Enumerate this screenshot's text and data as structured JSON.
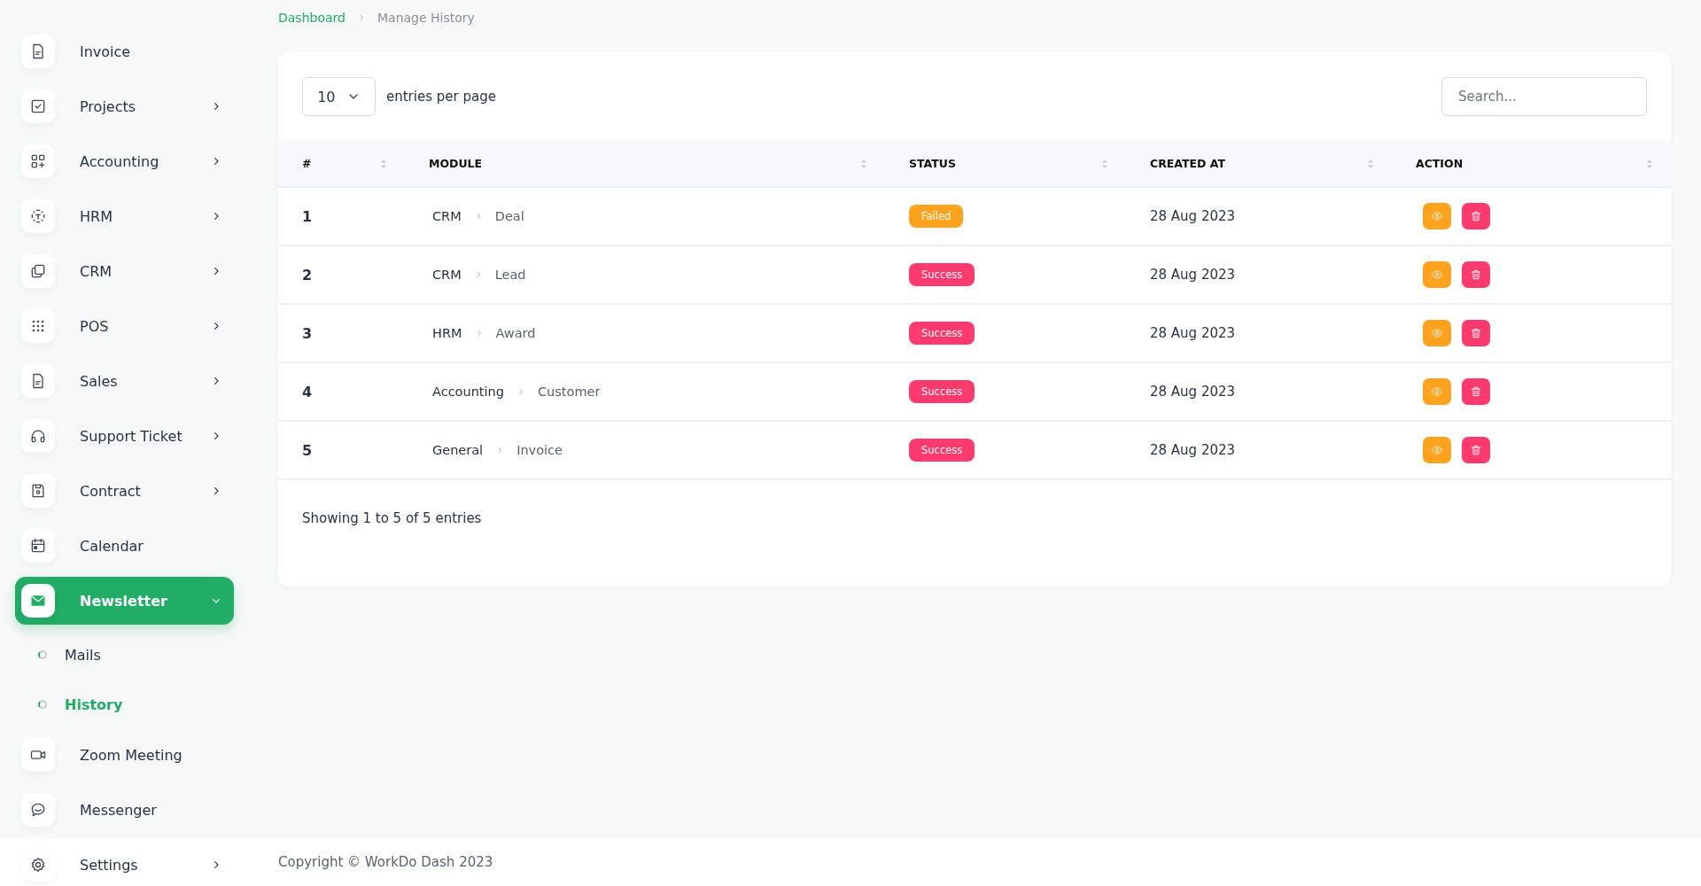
{
  "sidebar": {
    "items": [
      {
        "label": "Invoice",
        "kind": "link",
        "selected": false
      },
      {
        "label": "Projects",
        "kind": "group",
        "expanded": false,
        "selected": false
      },
      {
        "label": "Accounting",
        "kind": "group",
        "expanded": false,
        "selected": false
      },
      {
        "label": "HRM",
        "kind": "group",
        "expanded": false,
        "selected": false
      },
      {
        "label": "CRM",
        "kind": "group",
        "expanded": false,
        "selected": false
      },
      {
        "label": "POS",
        "kind": "group",
        "expanded": false,
        "selected": false
      },
      {
        "label": "Sales",
        "kind": "group",
        "expanded": false,
        "selected": false
      },
      {
        "label": "Support Ticket",
        "kind": "group",
        "expanded": false,
        "selected": false
      },
      {
        "label": "Contract",
        "kind": "group",
        "expanded": false,
        "selected": false
      },
      {
        "label": "Calendar",
        "kind": "link",
        "selected": false
      },
      {
        "label": "Newsletter",
        "kind": "group",
        "expanded": true,
        "selected": true,
        "children": [
          {
            "label": "Mails",
            "selected": false
          },
          {
            "label": "History",
            "selected": true
          }
        ]
      },
      {
        "label": "Zoom Meeting",
        "kind": "link",
        "selected": false
      },
      {
        "label": "Messenger",
        "kind": "link",
        "selected": false
      },
      {
        "label": "Settings",
        "kind": "group",
        "expanded": false,
        "selected": false
      }
    ]
  },
  "breadcrumb": [
    {
      "label": "Dashboard"
    },
    {
      "label": "Manage History"
    }
  ],
  "table": {
    "page_size": "10",
    "page_size_label": "entries per page",
    "search": {
      "placeholder": "Search..."
    },
    "columns": [
      "#",
      "MODULE",
      "STATUS",
      "CREATED AT",
      "ACTION"
    ],
    "rows": [
      {
        "number": "1",
        "module": "CRM",
        "submodule": "Deal",
        "status": "Failed",
        "color": "#ffa21d",
        "created_at": "28 Aug 2023"
      },
      {
        "number": "2",
        "module": "CRM",
        "submodule": "Lead",
        "status": "Success",
        "color": "#ff3a6e",
        "created_at": "28 Aug 2023"
      },
      {
        "number": "3",
        "module": "HRM",
        "submodule": "Award",
        "status": "Success",
        "color": "#ff3a6e",
        "created_at": "28 Aug 2023"
      },
      {
        "number": "4",
        "module": "Accounting",
        "submodule": "Customer",
        "status": "Success",
        "color": "#ff3a6e",
        "created_at": "28 Aug 2023"
      },
      {
        "number": "5",
        "module": "General",
        "submodule": "Invoice",
        "status": "Success",
        "color": "#ff3a6e",
        "created_at": "28 Aug 2023"
      }
    ],
    "info": "Showing 1 to 5 of 5 entries"
  },
  "footer": {
    "copyright": "Copyright © WorkDo Dash 2023"
  }
}
